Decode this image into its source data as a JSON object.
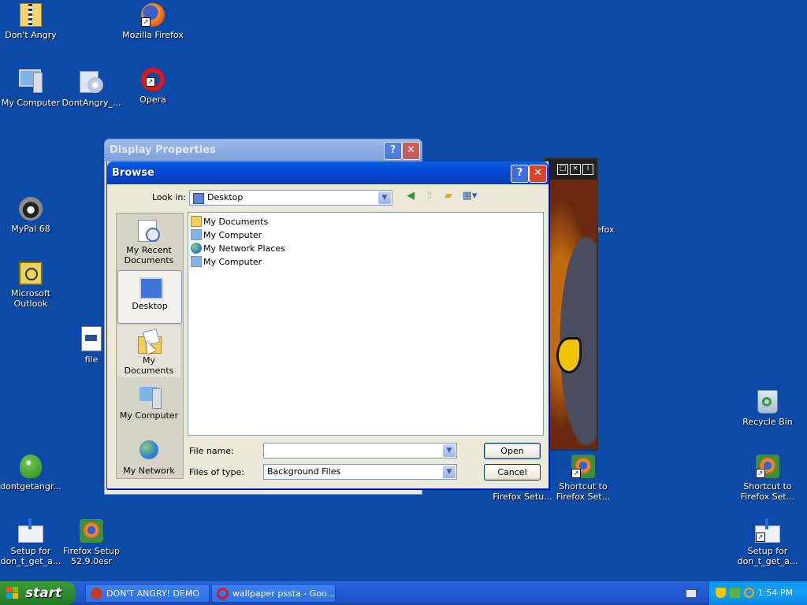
{
  "desktop": {
    "icons": [
      {
        "label": "Don't Angry",
        "icon": "zip-folder-icon"
      },
      {
        "label": "Mozilla Firefox",
        "icon": "firefox-icon"
      },
      {
        "label": "My Computer",
        "icon": "my-computer-icon"
      },
      {
        "label": "DontAngry_...",
        "icon": "installer-cd-icon"
      },
      {
        "label": "Opera",
        "icon": "opera-icon"
      },
      {
        "label": "MyPal 68",
        "icon": "mypal-raccoon-icon"
      },
      {
        "label": "Microsoft Outlook",
        "icon": "outlook-icon"
      },
      {
        "label": "file",
        "icon": "text-file-icon"
      },
      {
        "label": "dontgetangr...",
        "icon": "game-character-icon"
      },
      {
        "label": "Setup for don_t_get_a...",
        "icon": "setup-download-icon"
      },
      {
        "label": "Firefox Setup 52.9.0esr",
        "icon": "firefox-setup-icon"
      },
      {
        "label": "Shortcut to Firefox Setu...",
        "icon": "firefox-setup-shortcut-icon"
      },
      {
        "label": "Shortcut to Firefox Set...",
        "icon": "firefox-setup-shortcut-icon"
      },
      {
        "label": "Recycle Bin",
        "icon": "recycle-bin-icon"
      },
      {
        "label": "Shortcut to Firefox Set...",
        "icon": "firefox-setup-shortcut-icon"
      },
      {
        "label": "Setup for don_t_get_a...",
        "icon": "setup-download-icon"
      }
    ],
    "partial_label": "efox"
  },
  "display_properties": {
    "title": "Display Properties"
  },
  "browse": {
    "title": "Browse",
    "look_in_label": "Look in:",
    "look_in_value": "Desktop",
    "places": [
      "My Recent Documents",
      "Desktop",
      "My Documents",
      "My Computer",
      "My Network"
    ],
    "files": [
      "My Documents",
      "My Computer",
      "My Network Places",
      "My Computer"
    ],
    "file_name_label": "File name:",
    "file_name_value": "",
    "file_type_label": "Files of type:",
    "file_type_value": "Background Files",
    "open_label": "Open",
    "cancel_label": "Cancel"
  },
  "taskbar": {
    "start_label": "start",
    "tasks": [
      "DON'T ANGRY! DEMO",
      "wallpaper pssta - Goo..."
    ],
    "clock": "1:54 PM"
  },
  "colors": {
    "desktop": "#0b4aa6",
    "title_bar": "#0548d8",
    "dialog_bg": "#ece9d8"
  }
}
